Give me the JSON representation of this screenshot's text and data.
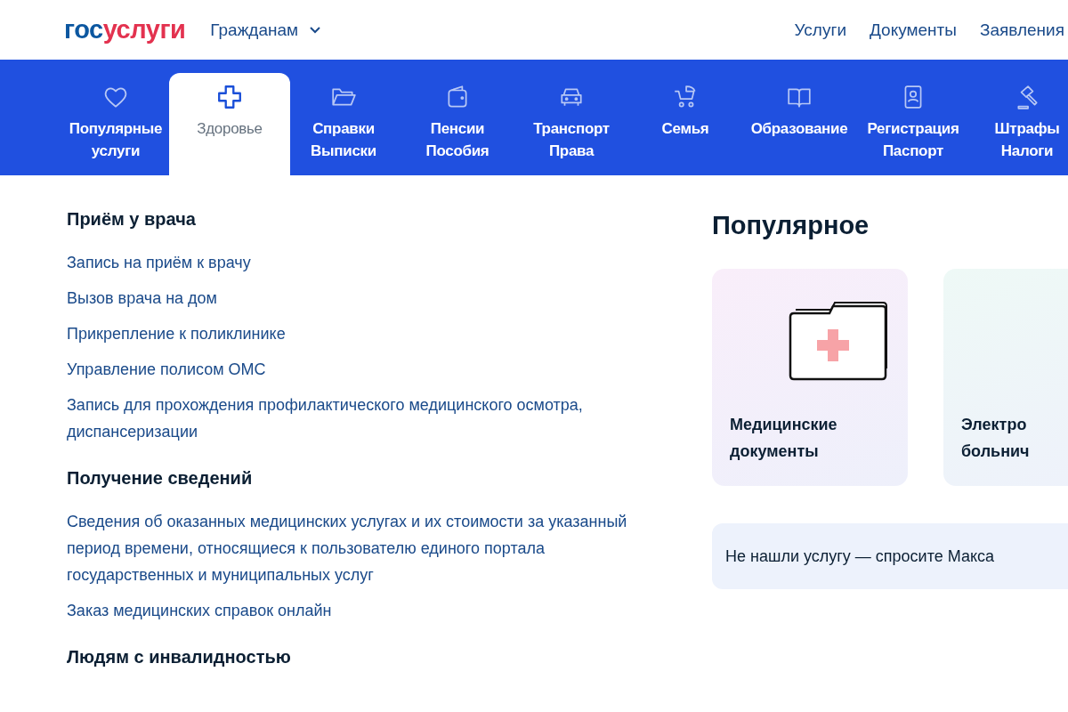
{
  "header": {
    "logo": {
      "first": "гос",
      "second": "услуги"
    },
    "audience": "Гражданам",
    "nav": [
      "Услуги",
      "Документы",
      "Заявления"
    ]
  },
  "categories": [
    {
      "lines": [
        "Популярные",
        "услуги"
      ],
      "selected": false
    },
    {
      "lines": [
        "Здоровье"
      ],
      "selected": true
    },
    {
      "lines": [
        "Справки",
        "Выписки"
      ],
      "selected": false
    },
    {
      "lines": [
        "Пенсии",
        "Пособия"
      ],
      "selected": false
    },
    {
      "lines": [
        "Транспорт",
        "Права"
      ],
      "selected": false
    },
    {
      "lines": [
        "Семья"
      ],
      "selected": false
    },
    {
      "lines": [
        "Образование"
      ],
      "selected": false
    },
    {
      "lines": [
        "Регистрация",
        "Паспорт"
      ],
      "selected": false
    },
    {
      "lines": [
        "Штрафы",
        "Налоги"
      ],
      "selected": false
    }
  ],
  "sections": [
    {
      "title": "Приём у врача",
      "links": [
        "Запись на приём к врачу",
        "Вызов врача на дом",
        "Прикрепление к поликлинике",
        "Управление полисом ОМС",
        "Запись для прохождения профилактического медицинского осмотра, диспансеризации"
      ]
    },
    {
      "title": "Получение сведений",
      "links": [
        "Сведения об оказанных медицинских услугах и их стоимости за указанный период времени, относящиеся к пользователю единого портала государственных и муниципальных услуг",
        "Заказ медицинских справок онлайн"
      ]
    },
    {
      "title": "Людям с инвалидностью"
    }
  ],
  "popular": {
    "title": "Популярное",
    "cards": [
      {
        "lines": [
          "Медицинские",
          "документы"
        ],
        "kind": "folder"
      },
      {
        "lines": [
          "Электро",
          "больнич"
        ],
        "kind": "blank"
      }
    ],
    "ask": "Не нашли услугу — спросите Макса"
  }
}
